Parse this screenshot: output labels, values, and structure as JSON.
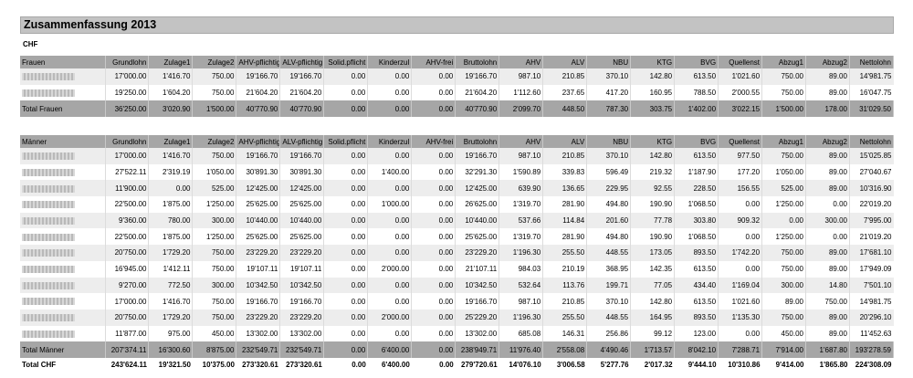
{
  "title": "Zusammenfassung 2013",
  "currency": "CHF",
  "columns": [
    "Grundlohn",
    "Zulage1",
    "Zulage2",
    "AHV-pflichtig",
    "ALV-pflichtig",
    "Solid.pflicht",
    "Kinderzul",
    "AHV-frei",
    "Bruttolohn",
    "AHV",
    "ALV",
    "NBU",
    "KTG",
    "BVG",
    "Quellenst",
    "Abzug1",
    "Abzug2",
    "Nettolohn"
  ],
  "frauen": {
    "label": "Frauen",
    "rows": [
      [
        "17'000.00",
        "1'416.70",
        "750.00",
        "19'166.70",
        "19'166.70",
        "0.00",
        "0.00",
        "0.00",
        "19'166.70",
        "987.10",
        "210.85",
        "370.10",
        "142.80",
        "613.50",
        "1'021.60",
        "750.00",
        "89.00",
        "14'981.75"
      ],
      [
        "19'250.00",
        "1'604.20",
        "750.00",
        "21'604.20",
        "21'604.20",
        "0.00",
        "0.00",
        "0.00",
        "21'604.20",
        "1'112.60",
        "237.65",
        "417.20",
        "160.95",
        "788.50",
        "2'000.55",
        "750.00",
        "89.00",
        "16'047.75"
      ]
    ],
    "total_label": "Total Frauen",
    "total": [
      "36'250.00",
      "3'020.90",
      "1'500.00",
      "40'770.90",
      "40'770.90",
      "0.00",
      "0.00",
      "0.00",
      "40'770.90",
      "2'099.70",
      "448.50",
      "787.30",
      "303.75",
      "1'402.00",
      "3'022.15",
      "1'500.00",
      "178.00",
      "31'029.50"
    ]
  },
  "maenner": {
    "label": "Männer",
    "rows": [
      [
        "17'000.00",
        "1'416.70",
        "750.00",
        "19'166.70",
        "19'166.70",
        "0.00",
        "0.00",
        "0.00",
        "19'166.70",
        "987.10",
        "210.85",
        "370.10",
        "142.80",
        "613.50",
        "977.50",
        "750.00",
        "89.00",
        "15'025.85"
      ],
      [
        "27'522.11",
        "2'319.19",
        "1'050.00",
        "30'891.30",
        "30'891.30",
        "0.00",
        "1'400.00",
        "0.00",
        "32'291.30",
        "1'590.89",
        "339.83",
        "596.49",
        "219.32",
        "1'187.90",
        "177.20",
        "1'050.00",
        "89.00",
        "27'040.67"
      ],
      [
        "11'900.00",
        "0.00",
        "525.00",
        "12'425.00",
        "12'425.00",
        "0.00",
        "0.00",
        "0.00",
        "12'425.00",
        "639.90",
        "136.65",
        "229.95",
        "92.55",
        "228.50",
        "156.55",
        "525.00",
        "89.00",
        "10'316.90"
      ],
      [
        "22'500.00",
        "1'875.00",
        "1'250.00",
        "25'625.00",
        "25'625.00",
        "0.00",
        "1'000.00",
        "0.00",
        "26'625.00",
        "1'319.70",
        "281.90",
        "494.80",
        "190.90",
        "1'068.50",
        "0.00",
        "1'250.00",
        "0.00",
        "22'019.20"
      ],
      [
        "9'360.00",
        "780.00",
        "300.00",
        "10'440.00",
        "10'440.00",
        "0.00",
        "0.00",
        "0.00",
        "10'440.00",
        "537.66",
        "114.84",
        "201.60",
        "77.78",
        "303.80",
        "909.32",
        "0.00",
        "300.00",
        "7'995.00"
      ],
      [
        "22'500.00",
        "1'875.00",
        "1'250.00",
        "25'625.00",
        "25'625.00",
        "0.00",
        "0.00",
        "0.00",
        "25'625.00",
        "1'319.70",
        "281.90",
        "494.80",
        "190.90",
        "1'068.50",
        "0.00",
        "1'250.00",
        "0.00",
        "21'019.20"
      ],
      [
        "20'750.00",
        "1'729.20",
        "750.00",
        "23'229.20",
        "23'229.20",
        "0.00",
        "0.00",
        "0.00",
        "23'229.20",
        "1'196.30",
        "255.50",
        "448.55",
        "173.05",
        "893.50",
        "1'742.20",
        "750.00",
        "89.00",
        "17'681.10"
      ],
      [
        "16'945.00",
        "1'412.11",
        "750.00",
        "19'107.11",
        "19'107.11",
        "0.00",
        "2'000.00",
        "0.00",
        "21'107.11",
        "984.03",
        "210.19",
        "368.95",
        "142.35",
        "613.50",
        "0.00",
        "750.00",
        "89.00",
        "17'949.09"
      ],
      [
        "9'270.00",
        "772.50",
        "300.00",
        "10'342.50",
        "10'342.50",
        "0.00",
        "0.00",
        "0.00",
        "10'342.50",
        "532.64",
        "113.76",
        "199.71",
        "77.05",
        "434.40",
        "1'169.04",
        "300.00",
        "14.80",
        "7'501.10"
      ],
      [
        "17'000.00",
        "1'416.70",
        "750.00",
        "19'166.70",
        "19'166.70",
        "0.00",
        "0.00",
        "0.00",
        "19'166.70",
        "987.10",
        "210.85",
        "370.10",
        "142.80",
        "613.50",
        "1'021.60",
        "89.00",
        "750.00",
        "14'981.75"
      ],
      [
        "20'750.00",
        "1'729.20",
        "750.00",
        "23'229.20",
        "23'229.20",
        "0.00",
        "2'000.00",
        "0.00",
        "25'229.20",
        "1'196.30",
        "255.50",
        "448.55",
        "164.95",
        "893.50",
        "1'135.30",
        "750.00",
        "89.00",
        "20'296.10"
      ],
      [
        "11'877.00",
        "975.00",
        "450.00",
        "13'302.00",
        "13'302.00",
        "0.00",
        "0.00",
        "0.00",
        "13'302.00",
        "685.08",
        "146.31",
        "256.86",
        "99.12",
        "123.00",
        "0.00",
        "450.00",
        "89.00",
        "11'452.63"
      ]
    ],
    "total_label": "Total Männer",
    "total": [
      "207'374.11",
      "16'300.60",
      "8'875.00",
      "232'549.71",
      "232'549.71",
      "0.00",
      "6'400.00",
      "0.00",
      "238'949.71",
      "11'976.40",
      "2'558.08",
      "4'490.46",
      "1'713.57",
      "8'042.10",
      "7'288.71",
      "7'914.00",
      "1'687.80",
      "193'278.59"
    ]
  },
  "grand_total": {
    "label": "Total CHF",
    "values": [
      "243'624.11",
      "19'321.50",
      "10'375.00",
      "273'320.61",
      "273'320.61",
      "0.00",
      "6'400.00",
      "0.00",
      "279'720.61",
      "14'076.10",
      "3'006.58",
      "5'277.76",
      "2'017.32",
      "9'444.10",
      "10'310.86",
      "9'414.00",
      "1'865.80",
      "224'308.09"
    ]
  }
}
